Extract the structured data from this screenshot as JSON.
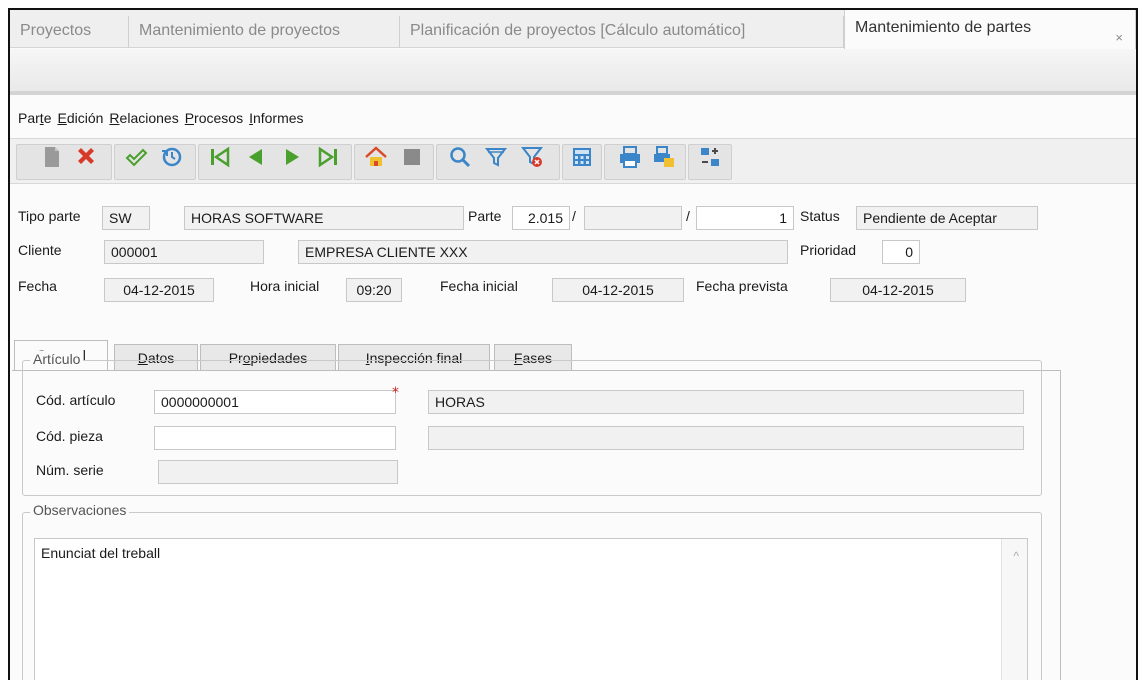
{
  "tabs": [
    {
      "label": "Proyectos"
    },
    {
      "label": "Mantenimiento de proyectos"
    },
    {
      "label": "Planificación de proyectos [Cálculo automático]"
    },
    {
      "label": "Mantenimiento de partes",
      "active": true
    }
  ],
  "tab_close": "×",
  "menu": [
    {
      "pre": "Par",
      "key": "t",
      "post": "e"
    },
    {
      "pre": "",
      "key": "E",
      "post": "dición"
    },
    {
      "pre": "",
      "key": "R",
      "post": "elaciones"
    },
    {
      "pre": "",
      "key": "P",
      "post": "rocesos"
    },
    {
      "pre": "",
      "key": "I",
      "post": "nformes"
    }
  ],
  "toolbar": {
    "buttons": [
      "new-icon",
      "delete-icon",
      "accept-icon",
      "undo-icon",
      "first-icon",
      "previous-icon",
      "next-icon",
      "last-icon",
      "home-icon",
      "stop-icon",
      "search-icon",
      "filter-icon",
      "clear-filter-icon",
      "calculator-icon",
      "print-icon",
      "print-preview-icon",
      "transfer-icon"
    ]
  },
  "form": {
    "tipo_parte_label": "Tipo parte",
    "tipo_parte_code": "SW",
    "tipo_parte_desc": "HORAS SOFTWARE",
    "parte_label": "Parte",
    "parte_year": "2.015",
    "parte_sep1": "/",
    "parte_serie": "",
    "parte_sep2": "/",
    "parte_number": "1",
    "status_label": "Status",
    "status_value": "Pendiente de Aceptar",
    "cliente_label": "Cliente",
    "cliente_code": "000001",
    "cliente_name": "EMPRESA CLIENTE XXX",
    "prioridad_label": "Prioridad",
    "prioridad_value": "0",
    "fecha_label": "Fecha",
    "fecha_value": "04-12-2015",
    "hora_inicial_label": "Hora inicial",
    "hora_inicial_value": "09:20",
    "fecha_inicial_label": "Fecha inicial",
    "fecha_inicial_value": "04-12-2015",
    "fecha_prevista_label": "Fecha prevista",
    "fecha_prevista_value": "04-12-2015"
  },
  "inner_tabs": [
    {
      "pre": "",
      "key": "G",
      "post": "eneral",
      "active": true
    },
    {
      "pre": "",
      "key": "D",
      "post": "atos"
    },
    {
      "pre": "Pr",
      "key": "o",
      "post": "piedades"
    },
    {
      "pre": "",
      "key": "I",
      "post": "nspección final"
    },
    {
      "pre": "",
      "key": "F",
      "post": "ases"
    }
  ],
  "articulo": {
    "group_title": "Artículo",
    "cod_articulo_label": "Cód. artículo",
    "cod_articulo_value": "0000000001",
    "required_mark": "*",
    "articulo_desc": "HORAS",
    "cod_pieza_label": "Cód. pieza",
    "cod_pieza_value": "",
    "pieza_desc": "",
    "num_serie_label": "Núm. serie",
    "num_serie_value": ""
  },
  "observaciones": {
    "group_title": "Observaciones",
    "text": "Enunciat del treball",
    "scroll_up": "^"
  }
}
